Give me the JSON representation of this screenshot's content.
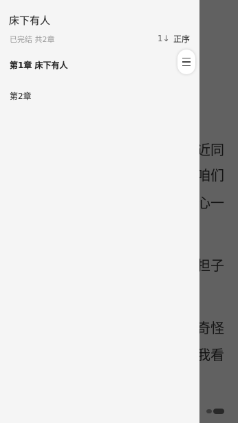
{
  "reader": {
    "lines": [
      "近同",
      "咱们",
      "心一",
      "担子",
      "奇怪",
      "我看"
    ]
  },
  "drawer": {
    "book_title": "床下有人",
    "meta": "已完结 共2章",
    "sort": {
      "icon": "sort-icon",
      "icon_glyph": "1↓",
      "label": "正序"
    },
    "chapters": [
      {
        "title": "第1章 床下有人",
        "current": true
      },
      {
        "title": "第2章",
        "current": false
      }
    ],
    "scroll_handle_icon": "menu-lines-icon"
  },
  "colors": {
    "drawer_bg": "#f5f5f5",
    "scrim": "rgba(0,0,0,0.62)",
    "text_primary": "#222222",
    "text_secondary": "#999999"
  }
}
